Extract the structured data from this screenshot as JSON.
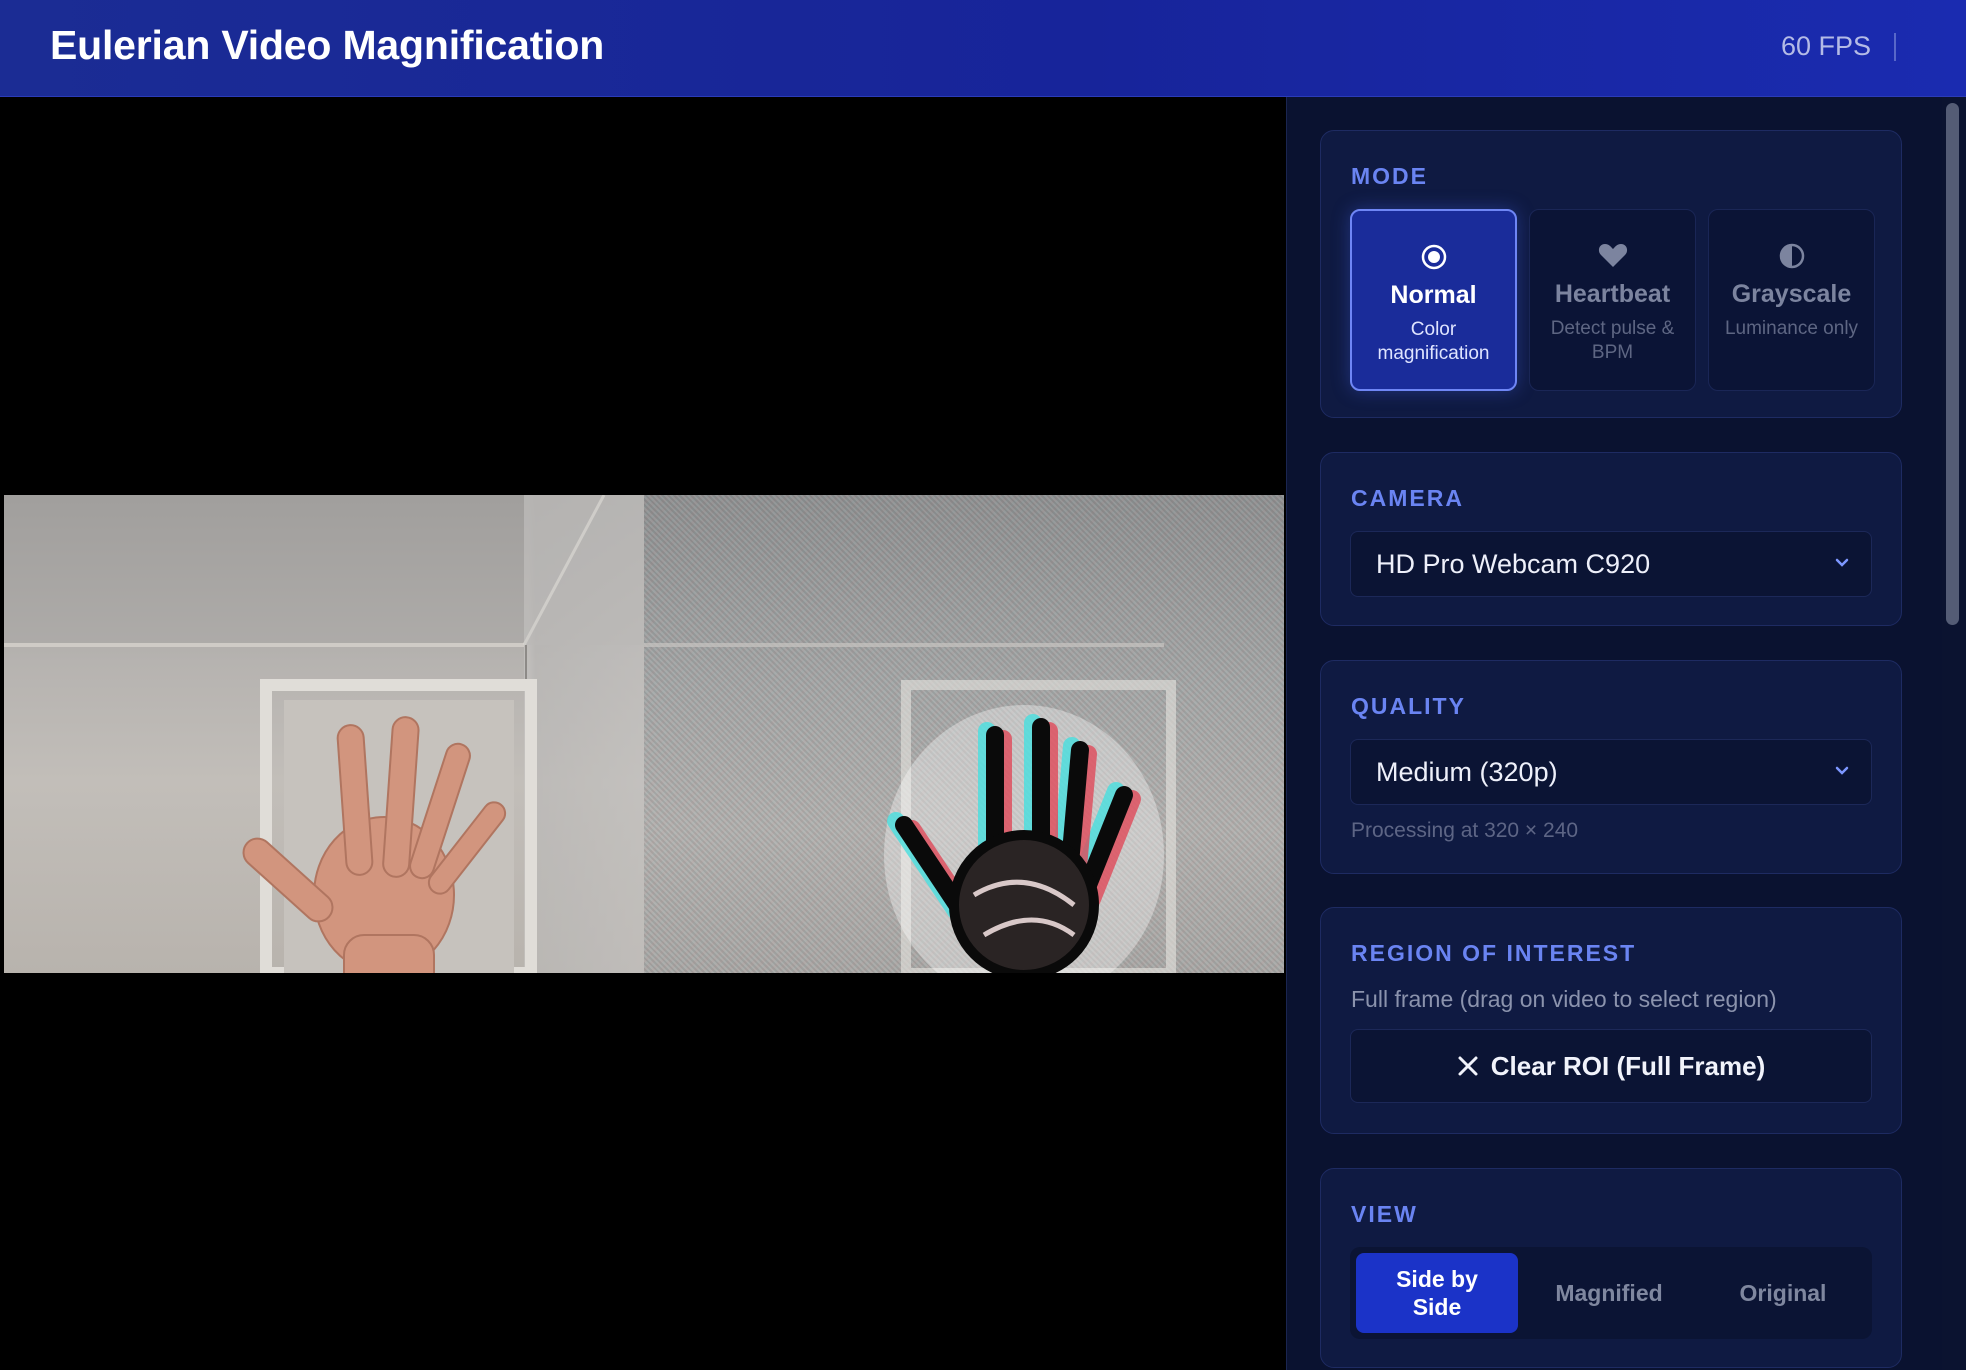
{
  "header": {
    "title": "Eulerian Video Magnification",
    "fps": "60 FPS"
  },
  "mode": {
    "title": "MODE",
    "options": [
      {
        "name": "Normal",
        "description": "Color magnification",
        "icon": "radio-icon",
        "active": true
      },
      {
        "name": "Heartbeat",
        "description": "Detect pulse & BPM",
        "icon": "heart-icon",
        "active": false
      },
      {
        "name": "Grayscale",
        "description": "Luminance only",
        "icon": "half-circle-icon",
        "active": false
      }
    ]
  },
  "camera": {
    "title": "CAMERA",
    "selected": "HD Pro Webcam C920"
  },
  "quality": {
    "title": "QUALITY",
    "selected": "Medium (320p)",
    "hint": "Processing at 320 × 240"
  },
  "roi": {
    "title": "REGION OF INTEREST",
    "status": "Full frame (drag on video to select region)",
    "clear_label": "Clear ROI (Full Frame)"
  },
  "view": {
    "title": "VIEW",
    "options": [
      {
        "label": "Side by Side",
        "active": true
      },
      {
        "label": "Magnified",
        "active": false
      },
      {
        "label": "Original",
        "active": false
      }
    ]
  },
  "colors": {
    "accent": "#6a84f2",
    "active_bg": "#1b33c8",
    "panel_bg": "#0a1230",
    "header_bg": "#1b2c94"
  }
}
